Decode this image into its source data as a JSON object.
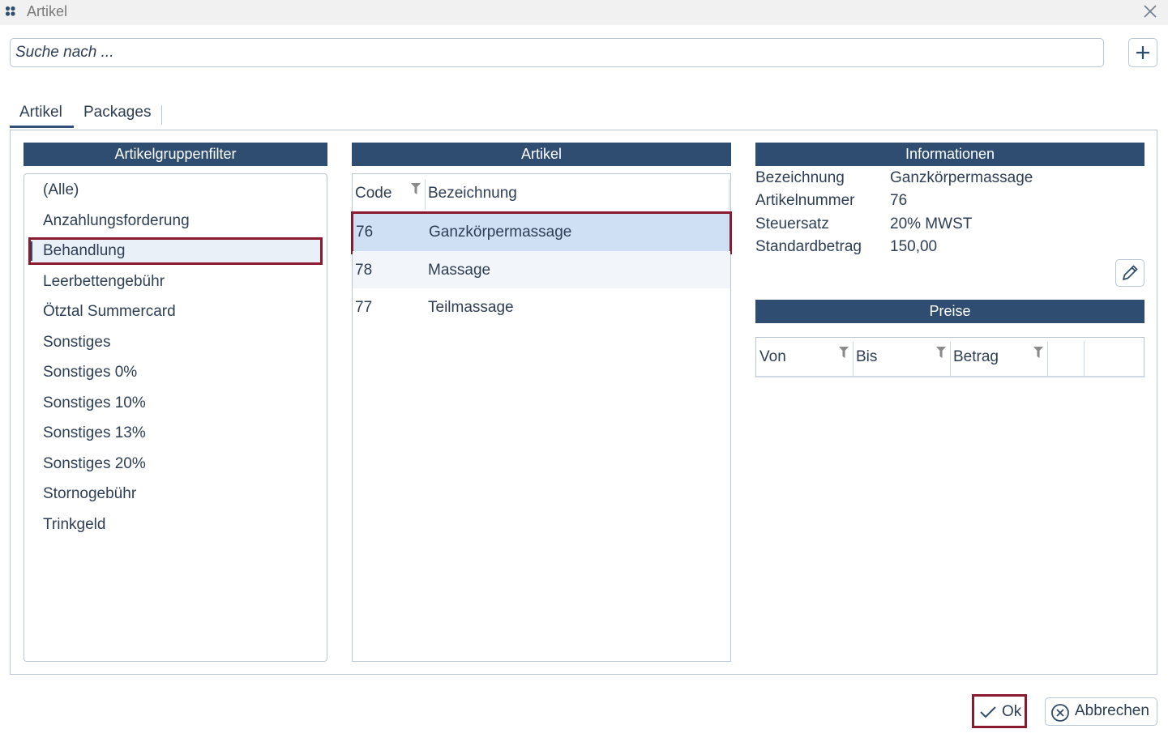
{
  "window": {
    "title": "Artikel"
  },
  "search": {
    "placeholder": "Suche nach ..."
  },
  "tabs": [
    {
      "label": "Artikel",
      "active": true
    },
    {
      "label": "Packages",
      "active": false
    }
  ],
  "groups": {
    "header": "Artikelgruppenfilter",
    "items": [
      {
        "label": "(Alle)"
      },
      {
        "label": "Anzahlungsforderung"
      },
      {
        "label": "Behandlung",
        "selected": true
      },
      {
        "label": "Leerbettengebühr"
      },
      {
        "label": "Ötztal Summercard"
      },
      {
        "label": "Sonstiges"
      },
      {
        "label": "Sonstiges 0%"
      },
      {
        "label": "Sonstiges 10%"
      },
      {
        "label": "Sonstiges 13%"
      },
      {
        "label": "Sonstiges 20%"
      },
      {
        "label": "Stornogebühr"
      },
      {
        "label": "Trinkgeld"
      }
    ]
  },
  "artikel": {
    "header": "Artikel",
    "columns": {
      "code": "Code",
      "name": "Bezeichnung"
    },
    "rows": [
      {
        "code": "76",
        "name": "Ganzkörpermassage",
        "selected": true
      },
      {
        "code": "78",
        "name": "Massage"
      },
      {
        "code": "77",
        "name": "Teilmassage"
      }
    ]
  },
  "info": {
    "header": "Informationen",
    "fields": [
      {
        "label": "Bezeichnung",
        "value": "Ganzkörpermassage"
      },
      {
        "label": "Artikelnummer",
        "value": "76"
      },
      {
        "label": "Steuersatz",
        "value": "20% MWST"
      },
      {
        "label": "Standardbetrag",
        "value": "150,00"
      }
    ]
  },
  "prices": {
    "header": "Preise",
    "columns": {
      "from": "Von",
      "to": "Bis",
      "amount": "Betrag"
    }
  },
  "footer": {
    "ok": "Ok",
    "cancel": "Abbrechen"
  },
  "colors": {
    "header": "#2f4d70",
    "highlight": "#8b1a2e",
    "selected_row": "#cfdff4",
    "text": "#2e3e55"
  }
}
